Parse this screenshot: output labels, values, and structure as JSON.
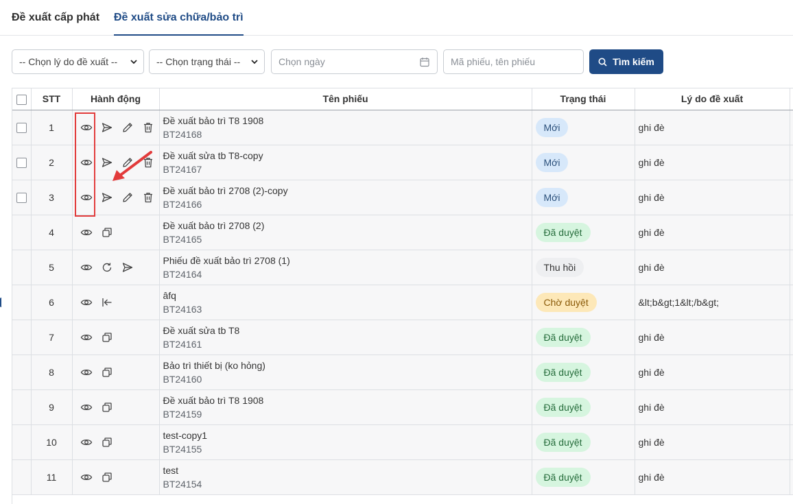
{
  "tabs": [
    {
      "label": "Đề xuất cấp phát",
      "active": false
    },
    {
      "label": "Đề xuất sửa chữa/bảo trì",
      "active": true
    }
  ],
  "filters": {
    "reason_select": "-- Chọn lý do đề xuất --",
    "status_select": "-- Chọn trạng thái --",
    "date_placeholder": "Chọn ngày",
    "search_placeholder": "Mã phiếu, tên phiếu",
    "search_button": "Tìm kiếm"
  },
  "table": {
    "headers": [
      "STT",
      "Hành động",
      "Tên phiếu",
      "Trạng thái",
      "Lý do đề xuất"
    ],
    "rows": [
      {
        "stt": "1",
        "name": "Đề xuất bảo trì T8 1908",
        "code": "BT24168",
        "status": "Mới",
        "reason": "ghi đè"
      },
      {
        "stt": "2",
        "name": "Đề xuất sửa tb T8-copy",
        "code": "BT24167",
        "status": "Mới",
        "reason": "ghi đè"
      },
      {
        "stt": "3",
        "name": "Đề xuất bảo trì 2708 (2)-copy",
        "code": "BT24166",
        "status": "Mới",
        "reason": "ghi đè"
      },
      {
        "stt": "4",
        "name": "Đề xuất bảo trì 2708 (2)",
        "code": "BT24165",
        "status": "Đã duyệt",
        "reason": "ghi đè"
      },
      {
        "stt": "5",
        "name": "Phiếu đề xuất bảo trì 2708 (1)",
        "code": "BT24164",
        "status": "Thu hồi",
        "reason": "ghi đè"
      },
      {
        "stt": "6",
        "name": "âfq",
        "code": "BT24163",
        "status": "Chờ duyệt",
        "reason": "&lt;b&gt;1&lt;/b&gt;"
      },
      {
        "stt": "7",
        "name": "Đề xuất sửa tb T8",
        "code": "BT24161",
        "status": "Đã duyệt",
        "reason": "ghi đè"
      },
      {
        "stt": "8",
        "name": "Bảo trì thiết bị (ko hỏng)",
        "code": "BT24160",
        "status": "Đã duyệt",
        "reason": "ghi đè"
      },
      {
        "stt": "9",
        "name": "Đề xuất bảo trì T8 1908",
        "code": "BT24159",
        "status": "Đã duyệt",
        "reason": "ghi đè"
      },
      {
        "stt": "10",
        "name": "test-copy1",
        "code": "BT24155",
        "status": "Đã duyệt",
        "reason": "ghi đè"
      },
      {
        "stt": "11",
        "name": "test",
        "code": "BT24154",
        "status": "Đã duyệt",
        "reason": "ghi đè"
      }
    ]
  },
  "colors": {
    "primary": "#1f4b86",
    "highlight": "#e23b3b",
    "badge_new": "#d7e8fa",
    "badge_approved": "#d6f5df",
    "badge_recalled": "#eeeff1",
    "badge_pending": "#fde8b8"
  }
}
